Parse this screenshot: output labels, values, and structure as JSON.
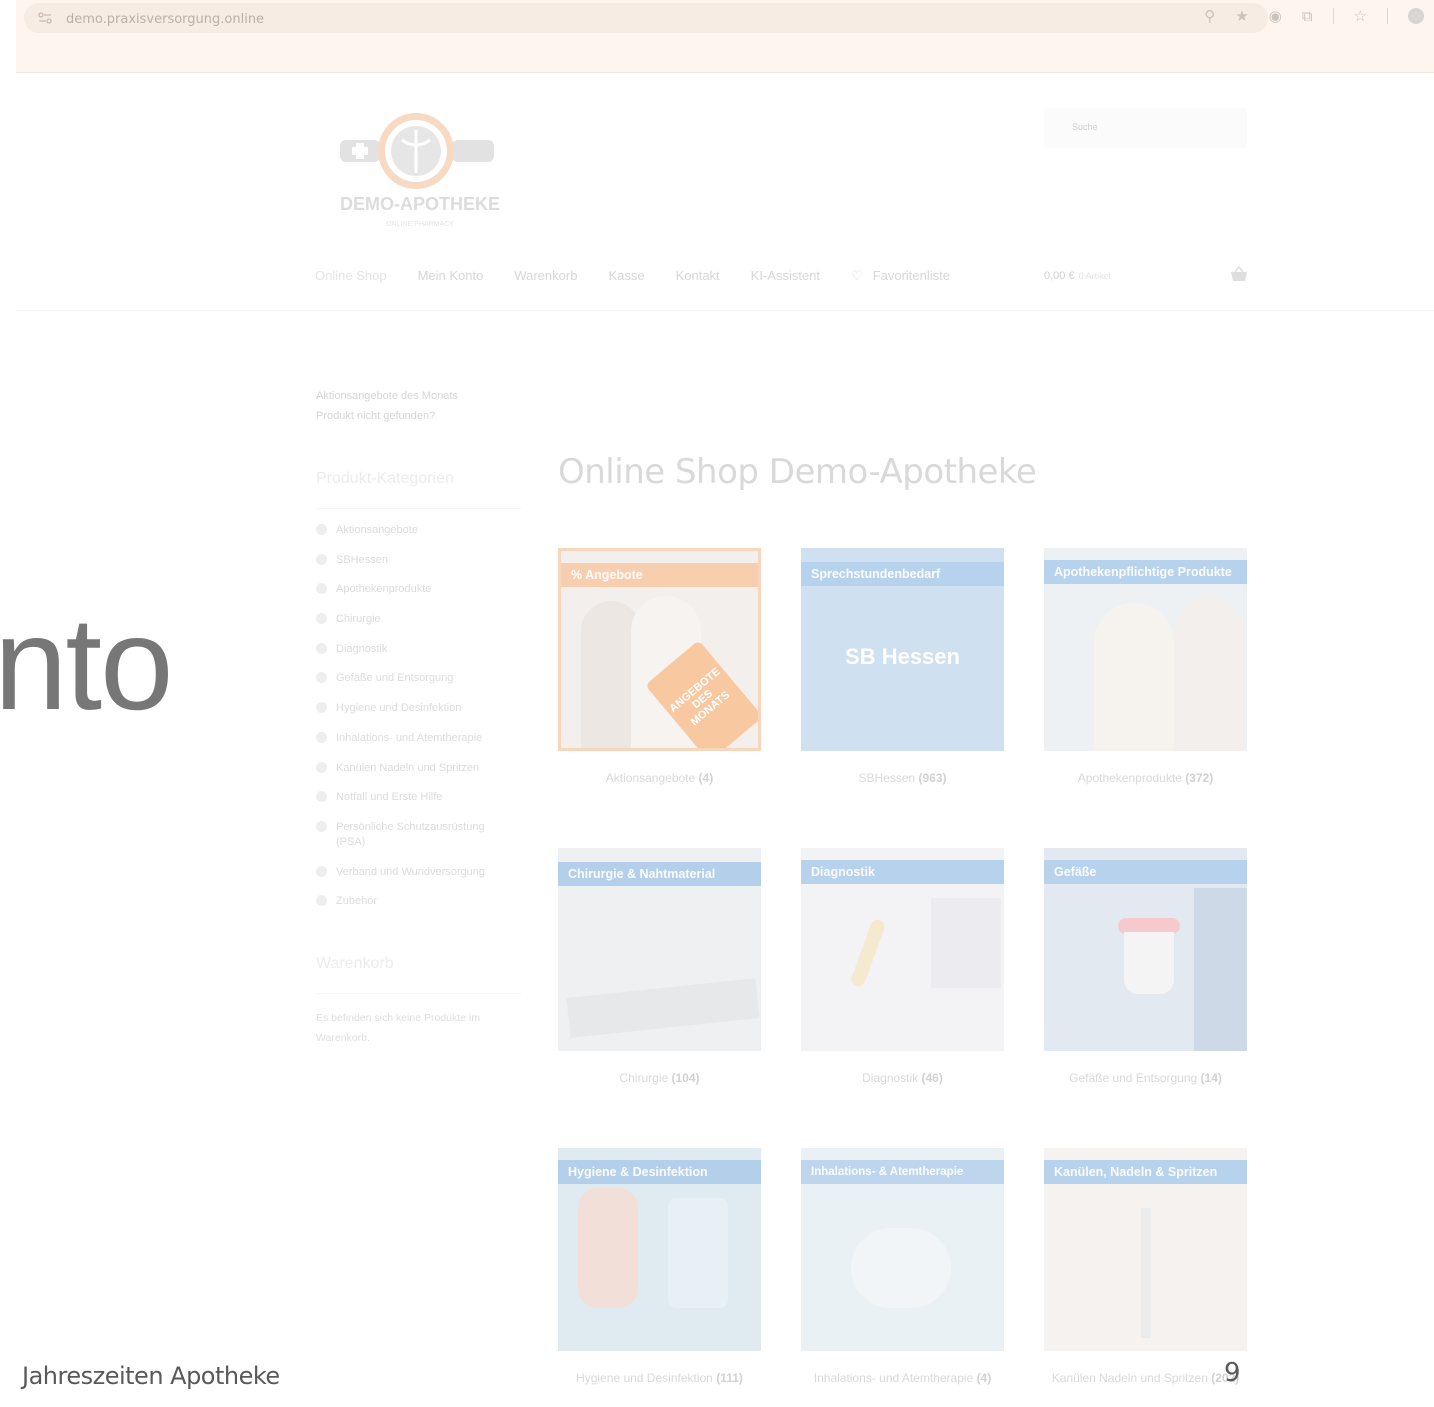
{
  "browser": {
    "url": "demo.praxisversorgung.online"
  },
  "header": {
    "logo_title": "DEMO-APOTHEKE",
    "logo_subtitle": "ONLINE PHARMACY",
    "search_placeholder": "Suche",
    "nav": [
      "Online Shop",
      "Mein Konto",
      "Warenkorb",
      "Kasse",
      "Kontakt",
      "KI-Assistent",
      "Favoritenliste"
    ],
    "cart_total": "0,00 €",
    "cart_items": "0 Artikel"
  },
  "sidebar": {
    "links": [
      "Aktionsangebote des Monats",
      "Produkt nicht gefunden?"
    ],
    "categories_title": "Produkt-Kategorien",
    "categories": [
      "Aktionsangebote",
      "SBHessen",
      "Apothekenprodukte",
      "Chirurgie",
      "Diagnostik",
      "Gefäße und Entsorgung",
      "Hygiene und Desinfektion",
      "Inhalations- und Atemtherapie",
      "Kanülen Nadeln und Spritzen",
      "Notfall und Erste Hilfe",
      "Persönliche Schutzausrüstung (PSA)",
      "Verband und Wundversorgung",
      "Zubehör"
    ],
    "cart_title": "Warenkorb",
    "cart_empty": "Es befinden sich keine Produkte im Warenkorb."
  },
  "main": {
    "title": "Online Shop Demo-Apotheke",
    "products": [
      {
        "banner": "% Angebote",
        "tag": "ANGEBOTE DES MONATS",
        "name": "Aktionsangebote",
        "count": "(4)"
      },
      {
        "banner": "Sprechstundenbedarf",
        "tag": "SB Hessen",
        "name": "SBHessen",
        "count": "(963)"
      },
      {
        "banner": "Apothekenpflichtige Produkte",
        "name": "Apothekenprodukte",
        "count": "(372)"
      },
      {
        "banner": "Chirurgie & Nahtmaterial",
        "name": "Chirurgie",
        "count": "(104)"
      },
      {
        "banner": "Diagnostik",
        "name": "Diagnostik",
        "count": "(46)"
      },
      {
        "banner": "Gefäße",
        "name": "Gefäße und Entsorgung",
        "count": "(14)"
      },
      {
        "banner": "Hygiene & Desinfektion",
        "name": "Hygiene und Desinfektion",
        "count": "(111)"
      },
      {
        "banner": "Inhalations- & Atemtherapie",
        "name": "Inhalations- und Atemtherapie",
        "count": "(4)"
      },
      {
        "banner": "Kanülen, Nadeln & Spritzen",
        "name": "Kanülen Nadeln und Spritzen",
        "count": "(202)"
      }
    ]
  },
  "slide": {
    "big_text": "nto",
    "footer": "Jahreszeiten Apotheke",
    "page_number": "9"
  },
  "colors": {
    "accent_orange": "#f6c49c",
    "banner_blue": "#a9c9ea",
    "overlay_text": "#595959"
  }
}
